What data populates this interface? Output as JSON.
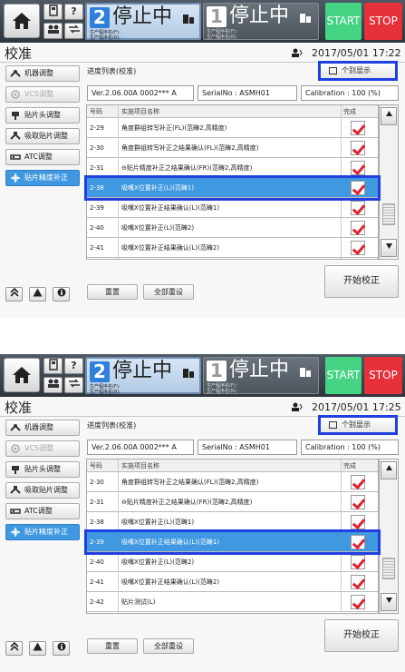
{
  "header": {
    "lane1": {
      "number": "2",
      "status": "停止中",
      "program_label": "生产程序名(F):\n生产程序名(R):"
    },
    "lane2": {
      "number": "1",
      "status": "停止中",
      "program_label": "生产程序名(F):\n生产程序名(R):"
    },
    "start_label": "START",
    "stop_label": "STOP",
    "help_label": "?",
    "colors": {
      "start": "#43d383",
      "stop": "#e6303a",
      "accent": "#3f98e0",
      "highlight": "#1f3fe0"
    }
  },
  "screens": [
    {
      "title": "校准",
      "datetime": "2017/05/01 17:22",
      "sidebar": [
        "机器调整",
        "VCS调整",
        "贴片头调整",
        "吸取贴片调整",
        "ATC调整",
        "贴片精度补正"
      ],
      "list_title": "进度列表(校准)",
      "individual_display": "个别显示",
      "version": "Ver.2.06.00A 0002*** A",
      "serial": "SerialNo : ASMH01",
      "calibration": "Calibration : 100 (%)",
      "columns": {
        "code": "号码",
        "name": "实施项目名称",
        "done": "完成"
      },
      "rows": [
        {
          "code": "2-29",
          "name": "角度群组转写补正(FL)(范畴2,高精度)",
          "done": true
        },
        {
          "code": "2-30",
          "name": "角度群组转写补正之结果确认(FL)(范畴2,高精度)",
          "done": true
        },
        {
          "code": "2-31",
          "name": "⊖贴片精度补正之结果确认(FR)(范畴2,高精度)",
          "done": true
        },
        {
          "code": "2-38",
          "name": "吸嘴X位置补正(L)(范畴1)",
          "done": true
        },
        {
          "code": "2-39",
          "name": "吸嘴X位置补正结果确认(L)(范畴1)",
          "done": true
        },
        {
          "code": "2-40",
          "name": "吸嘴X位置补正(L)(范畴2)",
          "done": true
        },
        {
          "code": "2-41",
          "name": "吸嘴X位置补正结果确认(L)(范畴2)",
          "done": true
        }
      ],
      "selected_row": "2-38",
      "start_calibration": "开始校正",
      "reset": "重置",
      "reset_all": "全部重设"
    },
    {
      "title": "校准",
      "datetime": "2017/05/01 17:25",
      "sidebar": [
        "机器调整",
        "VCS调整",
        "贴片头调整",
        "吸取贴片调整",
        "ATC调整",
        "贴片精度补正"
      ],
      "list_title": "进度列表(校准)",
      "individual_display": "个别显示",
      "version": "Ver.2.06.00A 0002*** A",
      "serial": "SerialNo : ASMH01",
      "calibration": "Calibration : 100 (%)",
      "columns": {
        "code": "号码",
        "name": "实施项目名称",
        "done": "完成"
      },
      "rows": [
        {
          "code": "2-30",
          "name": "角度群组转写补正之结果确认(FL)(范畴2,高精度)",
          "done": true
        },
        {
          "code": "2-31",
          "name": "⊖贴片精度补正之结果确认(FR)(范畴2,高精度)",
          "done": true
        },
        {
          "code": "2-38",
          "name": "吸嘴X位置补正(L)(范畴1)",
          "done": true
        },
        {
          "code": "2-39",
          "name": "吸嘴X位置补正结果确认(L)(范畴1)",
          "done": true
        },
        {
          "code": "2-40",
          "name": "吸嘴X位置补正(L)(范畴2)",
          "done": true
        },
        {
          "code": "2-41",
          "name": "吸嘴X位置补正结果确认(L)(范畴2)",
          "done": true
        },
        {
          "code": "2-42",
          "name": "贴片测试(L)",
          "done": true
        }
      ],
      "selected_row": "2-39",
      "start_calibration": "开始校正",
      "reset": "重置",
      "reset_all": "全部重设"
    }
  ]
}
